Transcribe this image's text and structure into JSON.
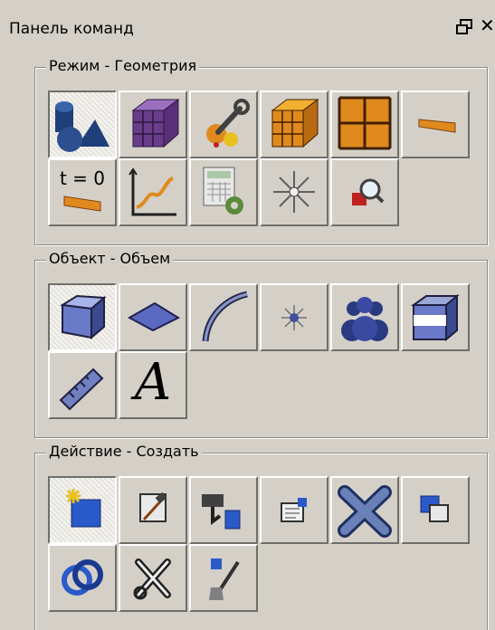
{
  "panel": {
    "title": "Панель команд"
  },
  "groups": [
    {
      "label": "Режим - Геометрия"
    },
    {
      "label": "Объект - Объем"
    },
    {
      "label": "Действие - Создать"
    }
  ],
  "buttons": {
    "time_zero_label": "t = 0",
    "text_tool_label": "A"
  },
  "colors": {
    "background": "#d4d0c8",
    "shape_blue": "#1f3f7a",
    "mesh_purple": "#6a3c8c",
    "orange": "#e08a1e"
  }
}
